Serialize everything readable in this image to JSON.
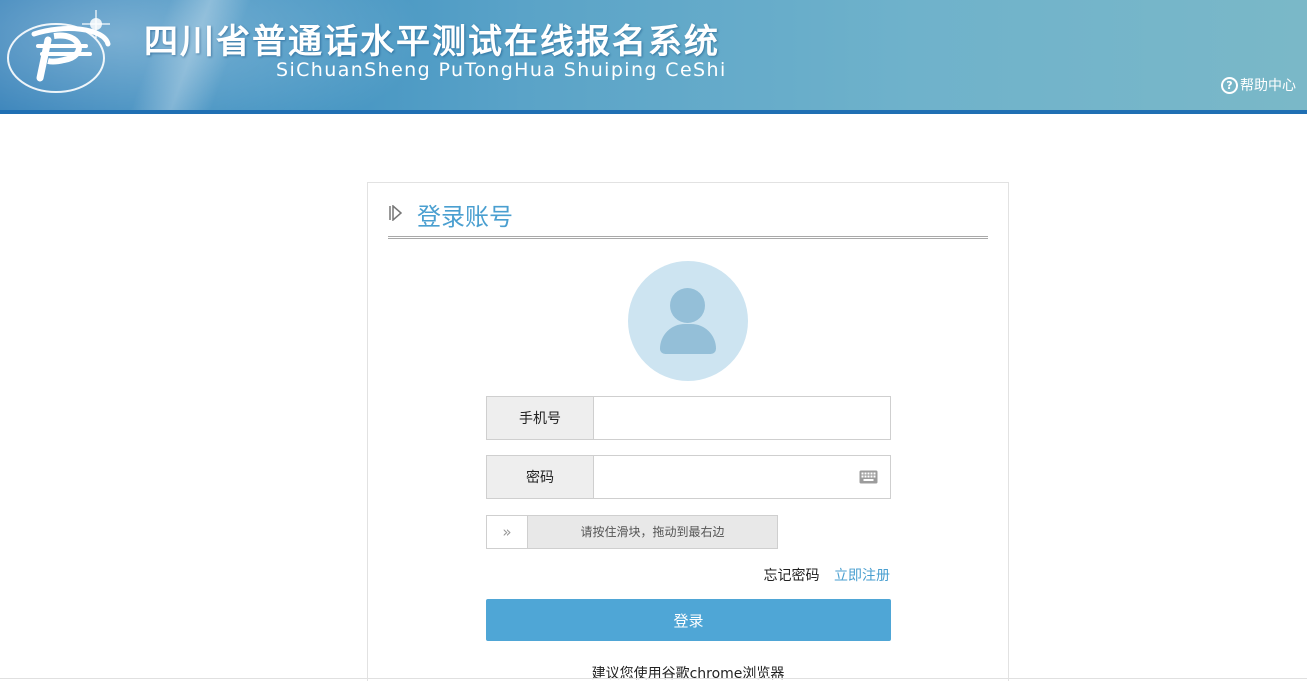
{
  "header": {
    "title_cn": "四川省普通话水平测试在线报名系统",
    "title_en": "SiChuanSheng PuTongHua Shuiping CeShi",
    "help_label": "帮助中心",
    "help_icon": "question-circle-icon",
    "logo_icon": "psc-logo-icon"
  },
  "login": {
    "title": "登录账号",
    "avatar_icon": "user-avatar-icon",
    "phone": {
      "label": "手机号",
      "value": "",
      "placeholder": ""
    },
    "password": {
      "label": "密码",
      "value": "",
      "placeholder": "",
      "icon": "keyboard-icon"
    },
    "slider": {
      "handle": "»",
      "hint": "请按住滑块，拖动到最右边"
    },
    "forget_label": "忘记密码",
    "register_label": "立即注册",
    "submit_label": "登录",
    "tip": "建议您使用谷歌chrome浏览器"
  },
  "colors": {
    "header_bg": "#3d8fc0",
    "accent": "#4a9fd0",
    "button": "#4fa6d6",
    "avatar_bg": "#cde4f1"
  }
}
